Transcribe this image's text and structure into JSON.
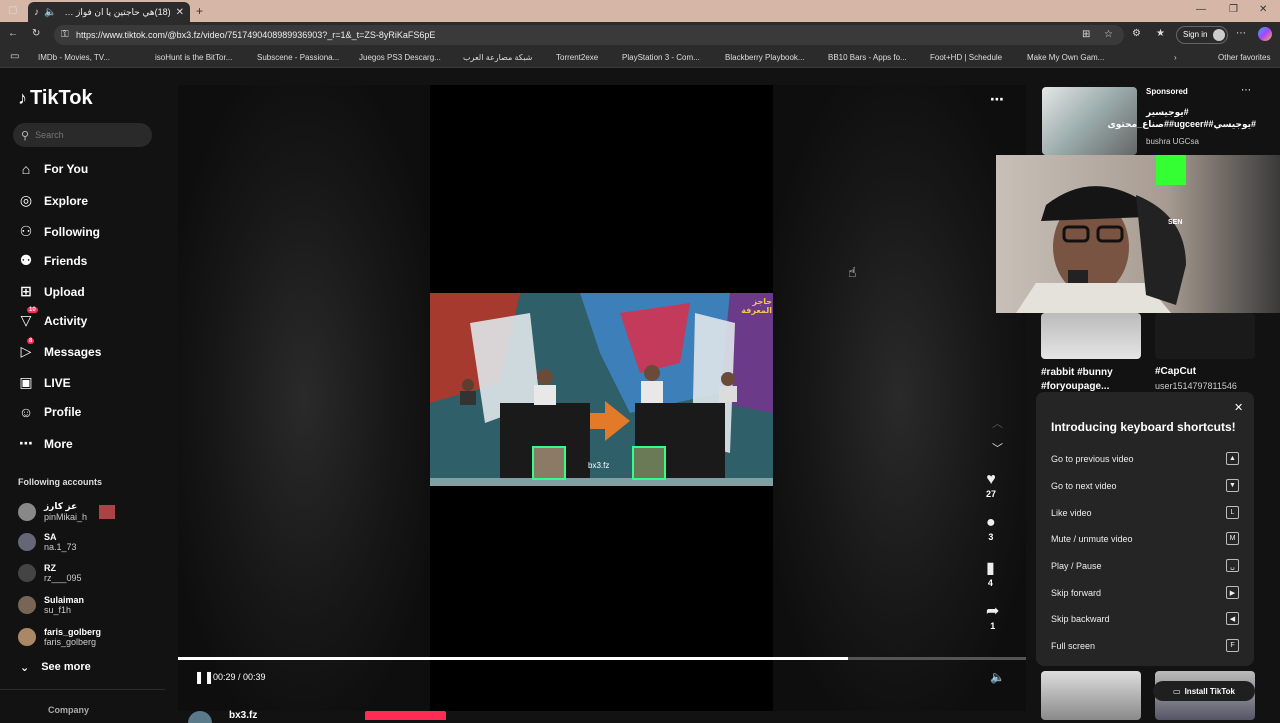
{
  "browser": {
    "tab_title": "(18)هي حاجتين يا ان فواز مشا",
    "url": "https://www.tiktok.com/@bx3.fz/video/7517490408989936903?_r=1&_t=ZS-8yRiKaFS6pE",
    "sign_in": "Sign in",
    "bookmarks": [
      "IMDb - Movies, TV...",
      "isoHunt is the BitTor...",
      "Subscene - Passiona...",
      "Juegos PS3 Descarg...",
      "شبكة مصارعة العرب",
      "Torrent2exe",
      "PlayStation 3 - Com...",
      "Blackberry Playbook...",
      "BB10 Bars - Apps fo...",
      "Foot+HD | Schedule",
      "Make My Own Gam..."
    ],
    "other_favorites": "Other favorites"
  },
  "sidebar": {
    "logo": "TikTok",
    "search_placeholder": "Search",
    "nav": [
      {
        "label": "For You",
        "icon": "home-icon"
      },
      {
        "label": "Explore",
        "icon": "compass-icon"
      },
      {
        "label": "Following",
        "icon": "user-follow-icon"
      },
      {
        "label": "Friends",
        "icon": "friends-icon"
      },
      {
        "label": "Upload",
        "icon": "plus-box-icon"
      },
      {
        "label": "Activity",
        "icon": "inbox-icon",
        "badge": "10"
      },
      {
        "label": "Messages",
        "icon": "send-icon",
        "badge": "8"
      },
      {
        "label": "LIVE",
        "icon": "live-icon"
      },
      {
        "label": "Profile",
        "icon": "profile-icon"
      },
      {
        "label": "More",
        "icon": "more-dots-icon"
      }
    ],
    "following_header": "Following accounts",
    "accounts": [
      {
        "name": "عز كارز",
        "handle": "pinMikai_h"
      },
      {
        "name": "SA",
        "handle": "na.1_73"
      },
      {
        "name": "RZ",
        "handle": "rz___095"
      },
      {
        "name": "Sulaiman",
        "handle": "su_f1h"
      },
      {
        "name": "faris_golberg",
        "handle": "faris_golberg"
      }
    ],
    "see_more": "See more",
    "company": "Company"
  },
  "player": {
    "time": "00:29 / 00:39",
    "progress": 0.79,
    "watermark": "bx3.fz",
    "scene_logo": "حاجز المعرفة",
    "author_partial": "bx3.fz",
    "actions": {
      "likes": "27",
      "comments": "3",
      "saves": "4",
      "shares": "1"
    }
  },
  "right_panel": {
    "sponsored": "Sponsored",
    "ad_title": "#يوجيسير #يوجيسي##ugceer##صناع_محتوى",
    "ad_author": "bushra UGCsa",
    "cap1": "#rabbit #bunny #foryoupage...",
    "cap2": "#CapCut",
    "cap2_user": "user1514797811546",
    "webcam_cap": "SEN",
    "install": "Install TikTok"
  },
  "shortcuts": {
    "title": "Introducing keyboard shortcuts!",
    "rows": [
      {
        "label": "Go to previous video",
        "key": "▲"
      },
      {
        "label": "Go to next video",
        "key": "▼"
      },
      {
        "label": "Like video",
        "key": "L"
      },
      {
        "label": "Mute / unmute video",
        "key": "M"
      },
      {
        "label": "Play / Pause",
        "key": "␣"
      },
      {
        "label": "Skip forward",
        "key": "▶"
      },
      {
        "label": "Skip backward",
        "key": "◀"
      },
      {
        "label": "Full screen",
        "key": "F"
      }
    ]
  }
}
